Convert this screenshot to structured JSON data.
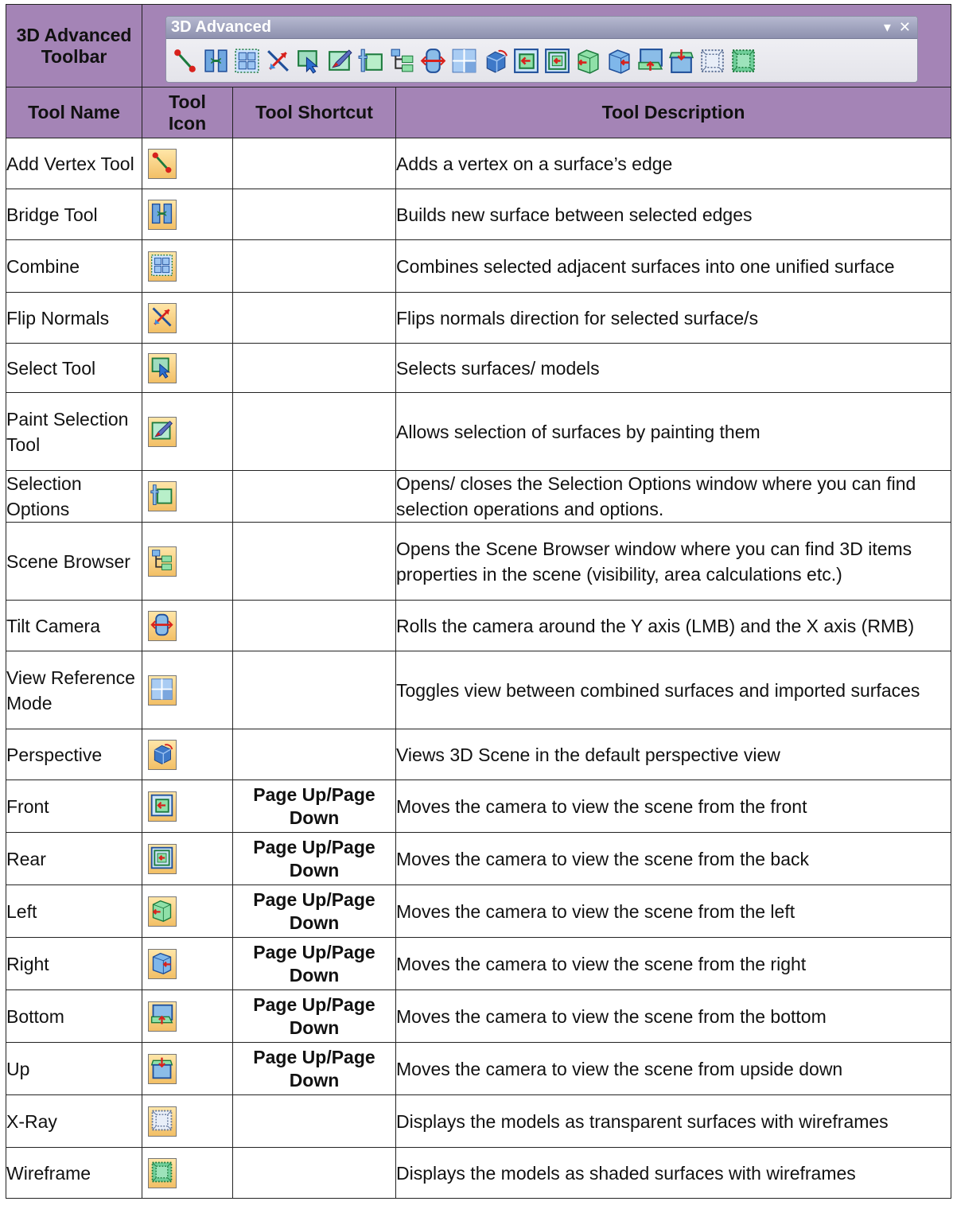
{
  "toolbar": {
    "label": "3D Advanced Toolbar",
    "window_title": "3D Advanced",
    "menu_glyph": "▾",
    "close_glyph": "✕",
    "icons": [
      "add-vertex-icon",
      "bridge-icon",
      "combine-icon",
      "flip-normals-icon",
      "select-icon",
      "paint-selection-icon",
      "selection-options-icon",
      "scene-browser-icon",
      "tilt-camera-icon",
      "view-reference-icon",
      "perspective-icon",
      "front-view-icon",
      "rear-view-icon",
      "left-view-icon",
      "right-view-icon",
      "bottom-view-icon",
      "up-view-icon",
      "x-ray-icon",
      "wireframe-icon"
    ]
  },
  "headers": {
    "name": "Tool Name",
    "icon": "Tool Icon",
    "shortcut": "Tool Shortcut",
    "description": "Tool Description"
  },
  "colors": {
    "header_bg": "#a484b6",
    "icon_bg_top": "#ffe6a8",
    "icon_bg_bottom": "#f2bf66"
  },
  "rows": [
    {
      "name": "Add Vertex Tool",
      "icon": "add-vertex-icon",
      "shortcut": "",
      "description": "Adds a vertex on a surface’s edge"
    },
    {
      "name": "Bridge Tool",
      "icon": "bridge-icon",
      "shortcut": "",
      "description": "Builds new surface between selected edges"
    },
    {
      "name": "Combine",
      "icon": "combine-icon",
      "shortcut": "",
      "description": "Combines selected adjacent surfaces into one unified surface"
    },
    {
      "name": "Flip Normals",
      "icon": "flip-normals-icon",
      "shortcut": "",
      "description": "Flips normals direction for selected surface/s"
    },
    {
      "name": "Select Tool",
      "icon": "select-icon",
      "shortcut": "",
      "description": "Selects surfaces/ models"
    },
    {
      "name": "Paint Selection Tool",
      "icon": "paint-selection-icon",
      "shortcut": "",
      "description": "Allows selection of surfaces by painting them"
    },
    {
      "name": "Selection Options",
      "icon": "selection-options-icon",
      "shortcut": "",
      "description": "Opens/ closes the Selection Options window where you can find selection operations and options."
    },
    {
      "name": "Scene Browser",
      "icon": "scene-browser-icon",
      "shortcut": "",
      "description": "Opens the Scene Browser window where you can find 3D items properties in the scene (visibility, area calculations etc.)"
    },
    {
      "name": "Tilt Camera",
      "icon": "tilt-camera-icon",
      "shortcut": "",
      "description": "Rolls the camera around the Y axis (LMB) and the X axis (RMB)"
    },
    {
      "name": "View Reference Mode",
      "icon": "view-reference-icon",
      "shortcut": "",
      "description": "Toggles view between combined surfaces and imported surfaces"
    },
    {
      "name": "Perspective",
      "icon": "perspective-icon",
      "shortcut": "",
      "description": "Views 3D Scene in the default perspective view"
    },
    {
      "name": "Front",
      "icon": "front-view-icon",
      "shortcut": "Page Up/Page Down",
      "description": "Moves the camera to view the scene from the front"
    },
    {
      "name": "Rear",
      "icon": "rear-view-icon",
      "shortcut": "Page Up/Page Down",
      "description": "Moves the camera to view the scene from the back"
    },
    {
      "name": "Left",
      "icon": "left-view-icon",
      "shortcut": "Page Up/Page Down",
      "description": "Moves the camera to view the scene from the left"
    },
    {
      "name": "Right",
      "icon": "right-view-icon",
      "shortcut": "Page Up/Page Down",
      "description": "Moves the camera to view the scene from the right"
    },
    {
      "name": "Bottom",
      "icon": "bottom-view-icon",
      "shortcut": "Page Up/Page Down",
      "description": "Moves the camera to view the scene from the bottom"
    },
    {
      "name": "Up",
      "icon": "up-view-icon",
      "shortcut": "Page Up/Page Down",
      "description": "Moves the camera to view the scene from upside down"
    },
    {
      "name": "X-Ray",
      "icon": "x-ray-icon",
      "shortcut": "",
      "description": "Displays the models as transparent surfaces with wireframes"
    },
    {
      "name": "Wireframe",
      "icon": "wireframe-icon",
      "shortcut": "",
      "description": "Displays the models as shaded surfaces with wireframes"
    }
  ]
}
